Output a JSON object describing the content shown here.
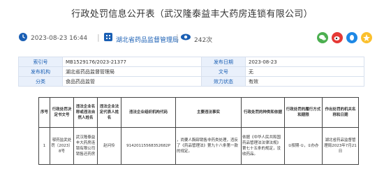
{
  "page": {
    "title": "行政处罚信息公开表（武汉隆泰益丰大药房连锁有限公司）"
  },
  "meta": {
    "datetime": "2023-08-23 16:44",
    "source": "湖北省药品监督管理局",
    "views": "242次"
  },
  "info": {
    "rows": [
      {
        "k1": "索引号",
        "v1": "MB1529176/2023-21377",
        "k2": "发布日期",
        "v2": "2023-08-23"
      },
      {
        "k1": "发布机构",
        "v1": "湖北省药品监督管理局",
        "k2": "文号",
        "v2": "无"
      },
      {
        "k1": "分类",
        "v1": "食品药品监管",
        "k2": "效力状态",
        "v2": "有效"
      }
    ]
  },
  "table": {
    "headers": [
      "序号",
      "行政处罚决定书文号",
      "违法企业名称或违法自然人姓名",
      "违法企业法定代表人姓名",
      "违法企业组织机构代码",
      "主要违法事实",
      "行政处罚的种类和依据",
      "行政处罚的履行方式和期限",
      "作出处罚的机关名称和日期"
    ],
    "row": {
      "no": "1",
      "doc_no": "鄂药监武处罚〔2023〕8号",
      "company": "武汉隆泰益丰大药房连锁有限公司销售还药房",
      "rep": "",
      "person": "赵问伶",
      "code": "91420115568352682P",
      "fact": "，尚要人胸部销售非药类处理，违反了《药品管理法》第九十八条第一款的规定。",
      "basis": "依据《中华人民共和国药品管理法法律法规》第七十五条的规定，没收药品。",
      "method": "①按期·①，②办办",
      "authority": "湖北省药品监督管理局2023年7月21日"
    }
  },
  "colors": {
    "accent_blue": "#1a5fb4",
    "header_bg": "#e9f0fb"
  },
  "icons": [
    "clock-icon",
    "building-icon",
    "eye-icon",
    "wechat-icon",
    "weibo-icon",
    "qq-icon",
    "qzone-icon"
  ]
}
